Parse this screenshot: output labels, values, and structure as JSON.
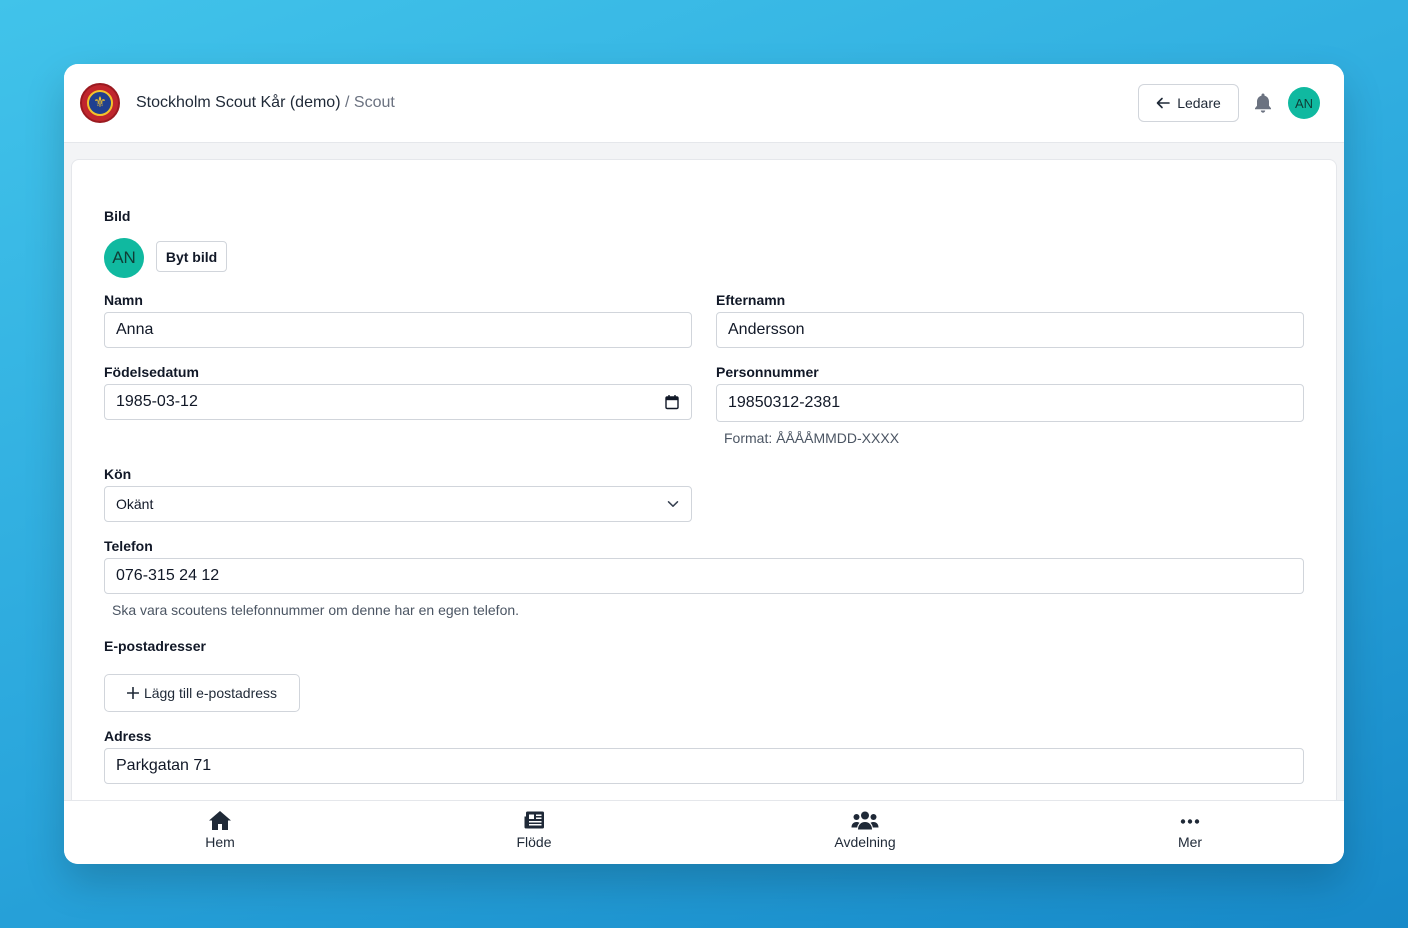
{
  "header": {
    "org_name": "Stockholm Scout Kår (demo)",
    "separator": "/",
    "section": "Scout",
    "back_button_label": "Ledare",
    "user_initials": "AN"
  },
  "form": {
    "picture": {
      "label": "Bild",
      "avatar_initials": "AN",
      "change_button_label": "Byt bild"
    },
    "first_name": {
      "label": "Namn",
      "value": "Anna"
    },
    "last_name": {
      "label": "Efternamn",
      "value": "Andersson"
    },
    "birth_date": {
      "label": "Födelsedatum",
      "value": "1985-03-12"
    },
    "personal_number": {
      "label": "Personnummer",
      "value": "19850312-2381",
      "hint": "Format: ÅÅÅÅMMDD-XXXX"
    },
    "gender": {
      "label": "Kön",
      "value": "Okänt"
    },
    "phone": {
      "label": "Telefon",
      "value": "076-315 24 12",
      "hint": "Ska vara scoutens telefonnummer om denne har en egen telefon."
    },
    "emails": {
      "label": "E-postadresser",
      "add_button_label": "Lägg till e-postadress"
    },
    "address": {
      "label": "Adress",
      "value": "Parkgatan 71"
    }
  },
  "bottom_nav": [
    {
      "label": "Hem",
      "icon": "home-icon"
    },
    {
      "label": "Flöde",
      "icon": "newspaper-icon"
    },
    {
      "label": "Avdelning",
      "icon": "users-icon"
    },
    {
      "label": "Mer",
      "icon": "more-icon"
    }
  ],
  "colors": {
    "avatar": "#10b9a0",
    "background_gradient_start": "#41c3ea",
    "background_gradient_end": "#1789c8"
  }
}
